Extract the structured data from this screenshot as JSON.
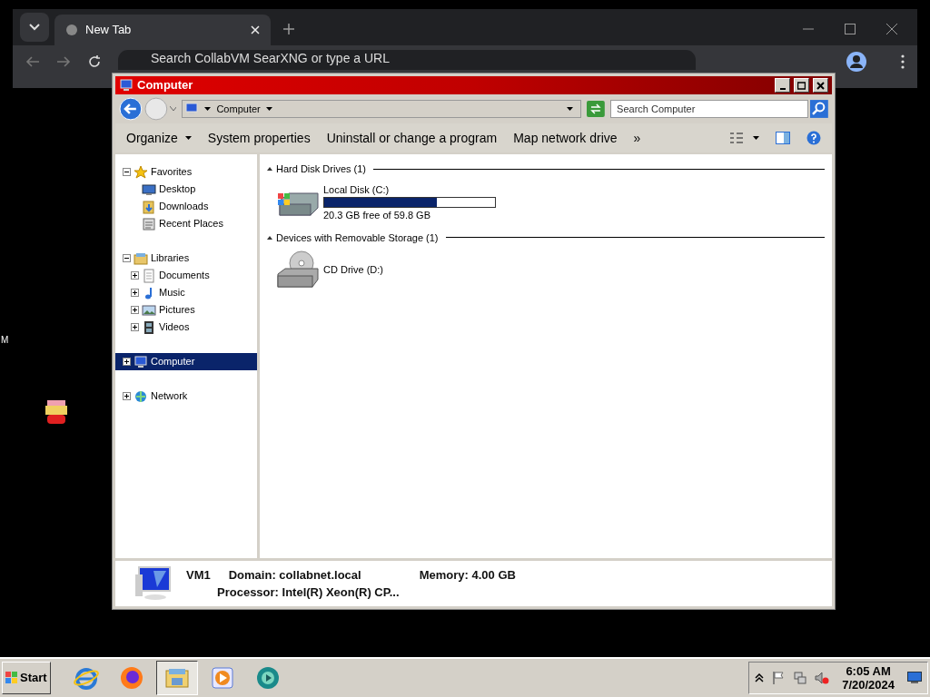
{
  "browser": {
    "tabs": [
      {
        "title": "New Tab",
        "selected": true
      }
    ],
    "omnibox": {
      "placeholder": "Search CollabVM SearXNG or type a URL"
    }
  },
  "desktop": {
    "labels": [
      "M"
    ]
  },
  "explorer": {
    "title": "Computer",
    "breadcrumb": [
      "Computer"
    ],
    "search": {
      "placeholder": "Search Computer"
    },
    "commands": [
      {
        "label": "Organize",
        "kind": "menu"
      },
      {
        "label": "System properties",
        "kind": "plain"
      },
      {
        "label": "Uninstall or change a program",
        "kind": "plain"
      },
      {
        "label": "Map network drive",
        "kind": "plain"
      },
      {
        "label": "»",
        "kind": "plain"
      }
    ],
    "nav": [
      {
        "label": "Favorites",
        "kind": "star",
        "expanded": true,
        "selected": false,
        "children": [
          {
            "label": "Desktop",
            "kind": "desktop",
            "selected": false
          },
          {
            "label": "Downloads",
            "kind": "downloads",
            "selected": false
          },
          {
            "label": "Recent Places",
            "kind": "recent",
            "selected": false
          }
        ]
      },
      {
        "label": "Libraries",
        "kind": "library",
        "expanded": true,
        "selected": false,
        "children": [
          {
            "label": "Documents",
            "kind": "document",
            "expanded": false,
            "selected": false
          },
          {
            "label": "Music",
            "kind": "music",
            "expanded": false,
            "selected": false
          },
          {
            "label": "Pictures",
            "kind": "pictures",
            "expanded": false,
            "selected": false
          },
          {
            "label": "Videos",
            "kind": "video",
            "expanded": false,
            "selected": false
          }
        ]
      },
      {
        "label": "Computer",
        "kind": "computer",
        "expanded": false,
        "selected": true
      },
      {
        "label": "Network",
        "kind": "network",
        "expanded": false,
        "selected": false
      }
    ],
    "sections": [
      {
        "title": "Hard Disk Drives (1)",
        "expanded": true,
        "items": [
          {
            "kind": "disk",
            "name": "Local Disk (C:)",
            "level": 0.66,
            "detail": "20.3 GB free of 59.8 GB"
          }
        ]
      },
      {
        "title": "Devices with Removable Storage (1)",
        "expanded": true,
        "items": [
          {
            "kind": "cd",
            "name": "CD Drive (D:)"
          }
        ]
      }
    ],
    "details": {
      "name": "VM1",
      "domain": "Domain: collabnet.local",
      "memory": "Memory: 4.00 GB",
      "processor": "Processor: Intel(R) Xeon(R) CP..."
    }
  },
  "taskbar": {
    "start": "Start",
    "apps": [
      {
        "kind": "ie",
        "selected": false
      },
      {
        "kind": "firefox",
        "selected": false
      },
      {
        "kind": "explorer",
        "selected": true
      },
      {
        "kind": "media",
        "selected": false
      },
      {
        "kind": "globe",
        "selected": false
      }
    ],
    "time": "6:05 AM",
    "date": "7/20/2024"
  }
}
